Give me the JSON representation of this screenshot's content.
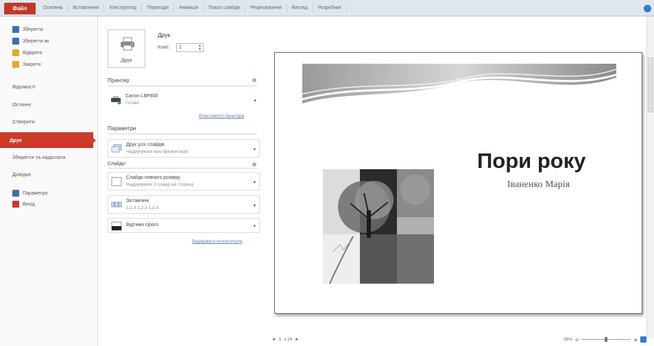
{
  "ribbon": {
    "file_tab": "Файл",
    "tabs": [
      "Основна",
      "Вставлення",
      "Конструктор",
      "Переходи",
      "Анімація",
      "Показ слайдів",
      "Рецензування",
      "Вигляд",
      "Розробник"
    ]
  },
  "backstage": {
    "commands": [
      {
        "label": "Зберегти",
        "icon": "save-icon",
        "color": "#3a6fb7"
      },
      {
        "label": "Зберегти як",
        "icon": "save-as-icon",
        "color": "#3a6fb7"
      },
      {
        "label": "Відкрити",
        "icon": "open-icon",
        "color": "#e3a92d"
      },
      {
        "label": "Закрити",
        "icon": "close-file-icon",
        "color": "#e3a92d"
      }
    ],
    "nav": [
      "Відомості",
      "Останні",
      "Створити",
      "Друк",
      "Зберегти та надіслати",
      "Довідка"
    ],
    "selected": "Друк",
    "bottom_commands": [
      {
        "label": "Параметри",
        "icon": "options-icon",
        "color": "#3a6fb7"
      },
      {
        "label": "Вихід",
        "icon": "exit-icon",
        "color": "#cc3333"
      }
    ]
  },
  "print": {
    "button_label": "Друк",
    "title": "Друк",
    "copies_label": "Копії:",
    "copies_value": "1",
    "printer_section": "Принтер",
    "printer_name": "Canon LBP800",
    "printer_status": "Готово",
    "printer_properties_link": "Властивості принтера",
    "settings_section": "Параметри",
    "settings": [
      {
        "line1": "Друк усіх слайдів",
        "line2": "Надрукувати всю презентацію",
        "icon": "slides-stack-icon"
      },
      {
        "line1": "Слайди повного розміру",
        "line2": "Надрукувати 1 слайд на сторінці",
        "icon": "full-page-slide-icon"
      },
      {
        "line1": "Зіставлені",
        "line2": "1,2,3   1,2,3   1,2,3",
        "icon": "collated-icon"
      },
      {
        "line1": "Відтінки сірого",
        "line2": "",
        "icon": "grayscale-icon"
      }
    ],
    "slides_label": "Слайди:",
    "edit_header_link": "Редагувати колонтитули"
  },
  "preview": {
    "slide_title": "Пори року",
    "slide_subtitle": "Іваненко Марія",
    "page_current": "1",
    "page_total": "з 14"
  },
  "zoom": {
    "level": "38%"
  },
  "colors": {
    "accent_red": "#cd3a2a",
    "ribbon_bg": "#dfe6ee"
  }
}
